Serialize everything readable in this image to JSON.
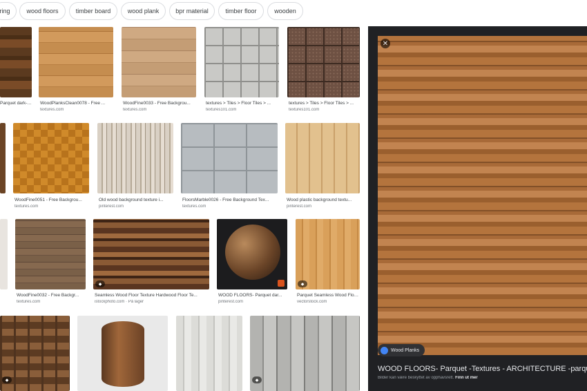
{
  "chips": [
    "ring",
    "wood floors",
    "timber board",
    "wood plank",
    "bpr material",
    "timber floor",
    "wooden"
  ],
  "results": [
    {
      "caption": "Parquet dark-T...",
      "source": ""
    },
    {
      "caption": "WoodPlanksClean0078 - Free ...",
      "source": "textures.com"
    },
    {
      "caption": "WoodFine0033 - Free Backgrou...",
      "source": "textures.com"
    },
    {
      "caption": "textures > Tiles > Floor Tiles > ...",
      "source": "textures101.com"
    },
    {
      "caption": "textures > Tiles > Floor Tiles > ...",
      "source": "textures101.com"
    },
    {
      "caption": "WoodFine0051 - Free Backgrou...",
      "source": "textures.com"
    },
    {
      "caption": "Old wood background texture i...",
      "source": "pinterest.com"
    },
    {
      "caption": "FloorsMarble0026 - Free Background Tex...",
      "source": "textures.com"
    },
    {
      "caption": "Wood plastic background textu...",
      "source": "pinterest.com"
    },
    {
      "caption": "WoodFine0032 - Free Backgr...",
      "source": "textures.com"
    },
    {
      "caption": "Seamless Wood Floor Texture Hardwood Floor Te...",
      "source": "istockphoto.com · På lager"
    },
    {
      "caption": "WOOD FLOORS- Parquet dar...",
      "source": "pinterest.com"
    },
    {
      "caption": "Parquet Seamless Wood Floor P...",
      "source": "vectorstock.com"
    }
  ],
  "preview": {
    "site_name": "Wood Planks",
    "title": "WOOD FLOORS- Parquet -Textures - ARCHITECTURE -parque",
    "subtitle": "Bilder kan være beskyttet av opphavsrett.",
    "learn_more": "Finn ut mer",
    "close_glyph": "✕"
  }
}
